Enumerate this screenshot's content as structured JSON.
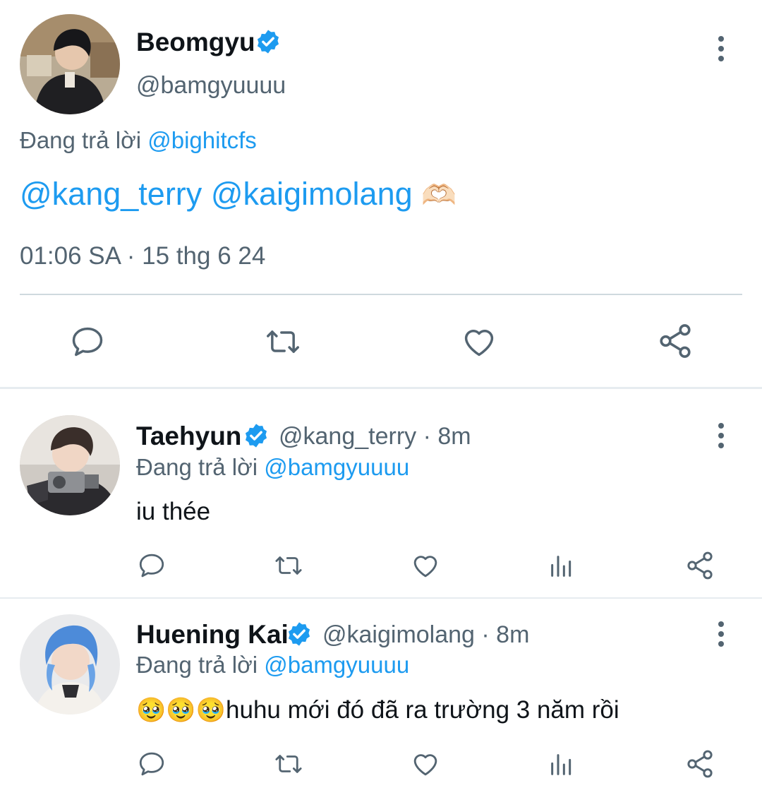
{
  "main_tweet": {
    "display_name": "Beomgyu",
    "handle": "@bamgyuuuu",
    "replying_label": "Đang trả lời",
    "replying_to": "@bighitcfs",
    "mention_1": "@kang_terry",
    "mention_2": "@kaigimolang",
    "emoji": "🫶🏻",
    "timestamp": "01:06 SA · 15 thg 6 24"
  },
  "replies": [
    {
      "display_name": "Taehyun",
      "handle": "@kang_terry · 8m",
      "replying_label": "Đang trả lời",
      "replying_to": "@bamgyuuuu",
      "text": "iu thée"
    },
    {
      "display_name": "Huening Kai",
      "handle": "@kaigimolang · 8m",
      "replying_label": "Đang trả lời",
      "replying_to": "@bamgyuuuu",
      "emoji": "🥹🥹🥹",
      "text": "huhu mới đó đã ra trường 3 năm rồi"
    }
  ],
  "icons": {
    "reply": "reply-icon",
    "retweet": "retweet-icon",
    "like": "like-icon",
    "views": "views-icon",
    "share": "share-icon",
    "more": "more-icon",
    "verified": "verified-badge-icon"
  },
  "colors": {
    "link": "#1d9bf0",
    "muted": "#536471",
    "text": "#0f1419",
    "verified": "#1d9bf0",
    "divider": "#cfd9de"
  }
}
